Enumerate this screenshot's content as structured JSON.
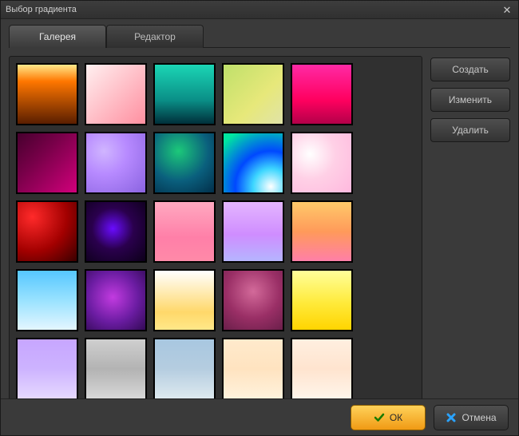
{
  "window": {
    "title": "Выбор градиента"
  },
  "tabs": {
    "gallery": "Галерея",
    "editor": "Редактор",
    "activeIndex": 0
  },
  "side_buttons": {
    "create": "Создать",
    "edit": "Изменить",
    "delete": "Удалить"
  },
  "footer": {
    "ok": "ОК",
    "cancel": "Отмена"
  },
  "gradients": [
    {
      "css": "linear-gradient(180deg,#ffe98a 0%,#ff7700 28%,#5a1e00 100%)"
    },
    {
      "css": "linear-gradient(135deg,#fff0f0 0%,#ff8fa0 100%)"
    },
    {
      "css": "linear-gradient(180deg,#1bd6b5 0%,#0a8f87 60%,#002f3a 100%)"
    },
    {
      "css": "linear-gradient(135deg,#bfe06a 0%,#e7e87a 60%,#e0e3a8 100%)"
    },
    {
      "css": "linear-gradient(180deg,#ff2aa5 0%,#ff005f 60%,#b30049 100%)"
    },
    {
      "css": "linear-gradient(135deg,#47002e 0%,#7a004a 40%,#d1007b 100%)"
    },
    {
      "css": "radial-gradient(circle at 30% 30%,#d0b5ff 0%,#b78aff 40%,#8a63e0 100%)"
    },
    {
      "css": "radial-gradient(circle at 40% 30%,#1cc97a 0%,#0a5f7d 55%,#022f4a 100%)"
    },
    {
      "css": "radial-gradient(circle at 80% 90%,#ffffff 0%,#3dd6ff 25%,#0048ff 50%,#00e6a0 90%)"
    },
    {
      "css": "radial-gradient(circle at 30% 35%,#ffffff 0%,#ffd0e6 45%,#ffb8de 100%)"
    },
    {
      "css": "radial-gradient(circle at 25% 25%,#ff2a2a 0%,#a30000 55%,#3a0000 100%)"
    },
    {
      "css": "radial-gradient(circle at 45% 45%,#6a0cff 0%,#2a004d 45%,#0c0018 100%)"
    },
    {
      "css": "linear-gradient(180deg,#ffa9c0 0%,#ff7fa8 60%,#ff8aa8 100%)"
    },
    {
      "css": "linear-gradient(180deg,#e4b6ff 0%,#cf8dff 55%,#b5b5ff 100%)"
    },
    {
      "css": "linear-gradient(180deg,#ffc96a 0%,#ff9a5a 50%,#ff7fa8 100%)"
    },
    {
      "css": "linear-gradient(180deg,#55c7ff 0%,#99e2ff 50%,#e4f6ff 100%)"
    },
    {
      "css": "radial-gradient(circle at 45% 45%,#c23be0 0%,#6a1ca1 55%,#320a55 100%)"
    },
    {
      "css": "linear-gradient(180deg,#ffffff 0%,#ffd86a 70%,#ffe889 100%)"
    },
    {
      "css": "radial-gradient(circle at 50% 35%,#d36a9a 0%,#9a2f66 55%,#6a1f4a 100%)"
    },
    {
      "css": "linear-gradient(180deg,#ffff9a 0%,#ffea3a 55%,#ffd400 100%)"
    },
    {
      "css": "linear-gradient(180deg,#c7a6ff 0%,#cdb3ff 50%,#e6d8ff 100%)"
    },
    {
      "css": "linear-gradient(180deg,#cfcfcf 0%,#b3b3b3 50%,#d7d7d7 100%)"
    },
    {
      "css": "linear-gradient(180deg,#a8c7e0 0%,#b5cde0 50%,#dde9ef 100%)"
    },
    {
      "css": "linear-gradient(180deg,#ffeacc 0%,#ffe3c0 50%,#fff2dc 100%)"
    },
    {
      "css": "linear-gradient(180deg,#ffefe0 0%,#ffe4cf 50%,#fff5ea 100%)"
    }
  ]
}
